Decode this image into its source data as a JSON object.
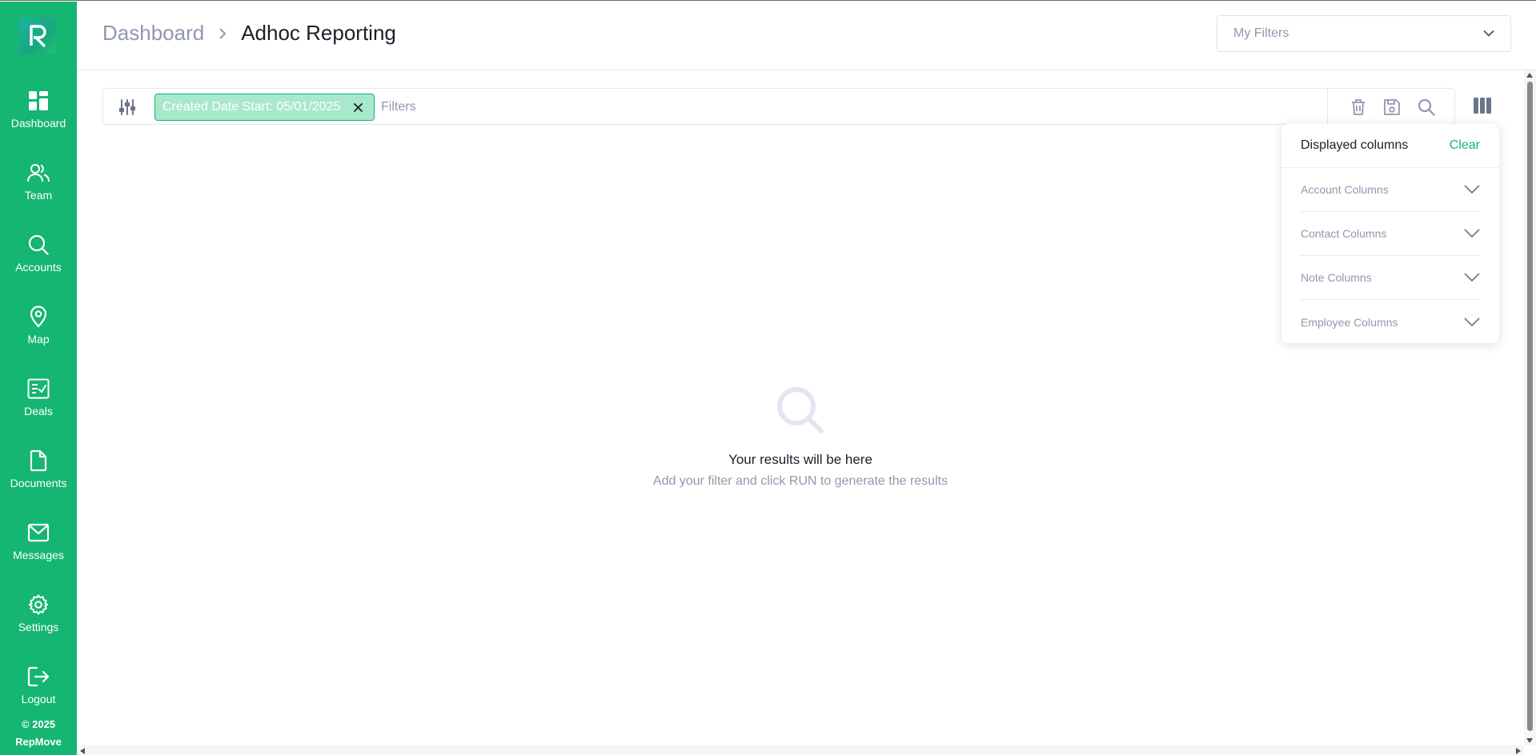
{
  "brand": {
    "logo_letter": "R",
    "copyright_year": "© 2025",
    "copyright_name": "RepMove"
  },
  "sidebar": {
    "items": [
      {
        "label": "Dashboard",
        "icon": "dashboard-icon"
      },
      {
        "label": "Team",
        "icon": "team-icon"
      },
      {
        "label": "Accounts",
        "icon": "search-icon"
      },
      {
        "label": "Map",
        "icon": "map-pin-icon"
      },
      {
        "label": "Deals",
        "icon": "deals-icon"
      },
      {
        "label": "Documents",
        "icon": "document-icon"
      },
      {
        "label": "Messages",
        "icon": "mail-icon"
      },
      {
        "label": "Settings",
        "icon": "gear-icon"
      },
      {
        "label": "Logout",
        "icon": "logout-icon"
      }
    ]
  },
  "header": {
    "breadcrumb_root": "Dashboard",
    "breadcrumb_current": "Adhoc Reporting",
    "my_filters_label": "My Filters"
  },
  "filterbar": {
    "chip_label": "Created Date Start: 05/01/2025",
    "input_placeholder": "Filters",
    "actions": [
      "trash-icon",
      "save-icon",
      "search-icon"
    ]
  },
  "columns_panel": {
    "title": "Displayed columns",
    "clear_label": "Clear",
    "groups": [
      {
        "label": "Account Columns"
      },
      {
        "label": "Contact Columns"
      },
      {
        "label": "Note Columns"
      },
      {
        "label": "Employee Columns"
      }
    ]
  },
  "empty_state": {
    "title": "Your results will be here",
    "subtitle": "Add your filter and click RUN to generate the results"
  },
  "colors": {
    "accent": "#15b572",
    "muted_text": "#8f98ad",
    "dark_text": "#1b1f2a",
    "chip_bg": "#a8e8cc"
  }
}
